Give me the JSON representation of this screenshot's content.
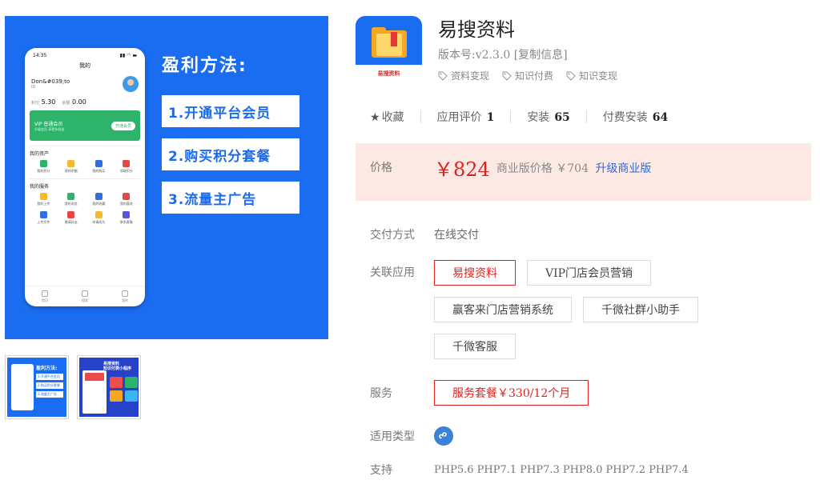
{
  "gallery": {
    "phone": {
      "time": "14:35",
      "title": "我的",
      "user_name": "Don&#039;to",
      "user_id": "ID",
      "points": [
        {
          "label": "积分",
          "value": "5.30"
        },
        {
          "label": "余额",
          "value": "0.00"
        }
      ],
      "vip_title": "VIP 普通会员",
      "vip_sub": "升级会员 享更多权益",
      "vip_button": "开通会员",
      "assets_title": "我的资产",
      "assets": [
        "我的积分",
        "我的余额",
        "我的购买",
        "领取积分"
      ],
      "services_title": "我的服务",
      "services": [
        "我的上传",
        "我的浏览",
        "我的收藏",
        "我的喜欢",
        "上传文件",
        "邀请好友",
        "申请成为",
        "联系客服"
      ],
      "tabs": [
        "首页",
        "搜索",
        "我的"
      ]
    },
    "promo_title": "盈利方法:",
    "promo_items": [
      "1.开通平台会员",
      "2.购买积分套餐",
      "3.流量主广告"
    ],
    "thumb1": {
      "title": "盈利方法:",
      "items": [
        "1.开通平台会员",
        "2.购买积分套餐",
        "3.流量主广告"
      ]
    },
    "thumb2": {
      "line1": "易搜资料",
      "line2": "知识付费小程序"
    }
  },
  "app": {
    "logo_text": "易搜资料",
    "name": "易搜资料",
    "version_label": "版本号:",
    "version": "v2.3.0",
    "copy_info": "[复制信息]",
    "tags": [
      "资料变现",
      "知识付费",
      "知识变现"
    ]
  },
  "stats": {
    "favorite": "收藏",
    "rating_label": "应用评价",
    "rating_value": "1",
    "install_label": "安装",
    "install_value": "65",
    "paid_install_label": "付费安装",
    "paid_install_value": "64"
  },
  "price": {
    "label": "价格",
    "main": "￥824",
    "business_label": "商业版价格 ￥704",
    "upgrade": "升级商业版"
  },
  "delivery": {
    "label": "交付方式",
    "value": "在线交付"
  },
  "related": {
    "label": "关联应用",
    "items": [
      "易搜资料",
      "VIP门店会员营销",
      "赢客来门店营销系统",
      "千微社群小助手",
      "千微客服"
    ]
  },
  "service": {
    "label": "服务",
    "value": "服务套餐￥330/12个月"
  },
  "types": {
    "label": "适用类型"
  },
  "support": {
    "label": "支持",
    "value": "PHP5.6 PHP7.1 PHP7.3 PHP8.0 PHP7.2 PHP7.4"
  },
  "colors": {
    "brand_blue": "#1a6cf0",
    "price_red": "#e02020",
    "price_bg": "#fde9e4",
    "link_blue": "#2e6ad8"
  }
}
